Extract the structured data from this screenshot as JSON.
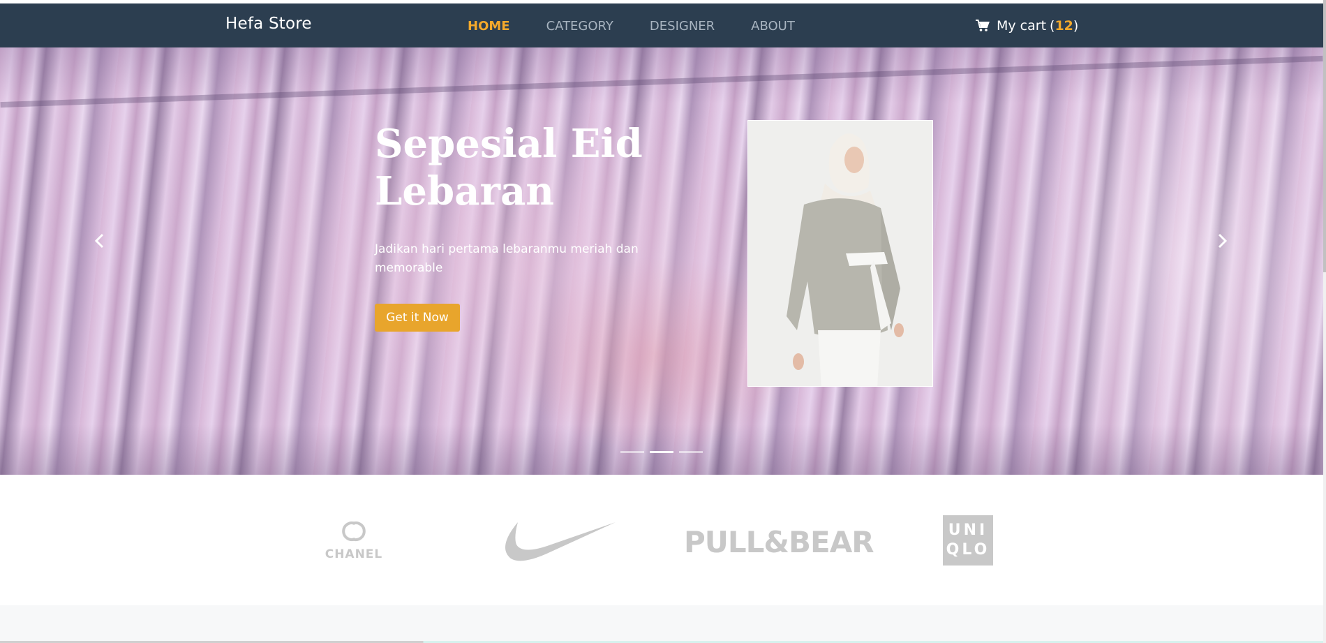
{
  "navbar": {
    "brand": "Hefa Store",
    "links": [
      {
        "label": "HOME",
        "active": true
      },
      {
        "label": "CATEGORY",
        "active": false
      },
      {
        "label": "DESIGNER",
        "active": false
      },
      {
        "label": "ABOUT",
        "active": false
      }
    ],
    "cart": {
      "label": "My cart",
      "open_paren": "(",
      "count": "12",
      "close_paren": ")",
      "icon": "cart-icon"
    }
  },
  "hero": {
    "title": "Sepesial Eid Lebaran",
    "subtitle": "Jadikan hari pertama lebaranmu meriah dan memorable",
    "button_label": "Get it Now",
    "prev_icon": "chevron-left-icon",
    "next_icon": "chevron-right-icon",
    "slides_count": 3,
    "active_slide": 2
  },
  "brands": [
    {
      "name": "CHANEL"
    },
    {
      "name": "Nike"
    },
    {
      "name": "PULL&BEAR"
    },
    {
      "name": "UNIQLO",
      "lines": [
        "UNI",
        "QLO"
      ]
    }
  ],
  "colors": {
    "navbar_bg": "#2c3e50",
    "accent": "#f4a92b",
    "button_bg": "#e8a52c",
    "logo_gray": "#c8c8c8"
  }
}
